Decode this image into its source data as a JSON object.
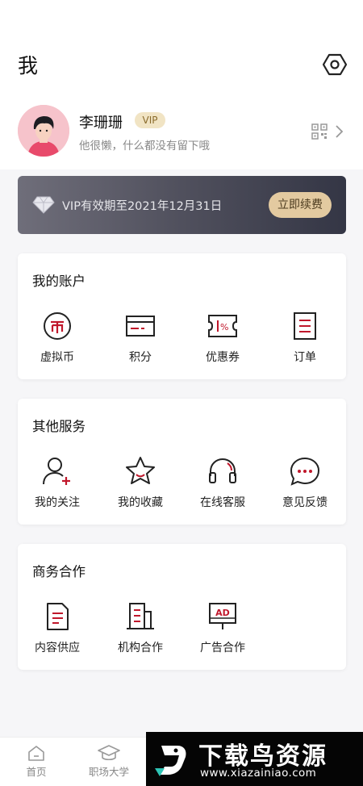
{
  "header": {
    "title": "我",
    "settings_icon": "settings-hexagon-icon"
  },
  "profile": {
    "name": "李珊珊",
    "vip_label": "VIP",
    "bio": "他很懒，什么都没有留下哦",
    "qr_icon": "qr-code-icon",
    "arrow_icon": "chevron-right-icon"
  },
  "vip_banner": {
    "text": "VIP有效期至2021年12月31日",
    "button": "立即续费",
    "icon": "diamond-icon"
  },
  "account": {
    "title": "我的账户",
    "items": [
      {
        "label": "虚拟币",
        "icon": "coin-icon"
      },
      {
        "label": "积分",
        "icon": "card-icon"
      },
      {
        "label": "优惠券",
        "icon": "coupon-icon"
      },
      {
        "label": "订单",
        "icon": "order-icon"
      }
    ]
  },
  "services": {
    "title": "其他服务",
    "items": [
      {
        "label": "我的关注",
        "icon": "follow-user-icon"
      },
      {
        "label": "我的收藏",
        "icon": "star-icon"
      },
      {
        "label": "在线客服",
        "icon": "headset-icon"
      },
      {
        "label": "意见反馈",
        "icon": "chat-bubble-icon"
      }
    ]
  },
  "business": {
    "title": "商务合作",
    "items": [
      {
        "label": "内容供应",
        "icon": "document-icon"
      },
      {
        "label": "机构合作",
        "icon": "building-icon"
      },
      {
        "label": "广告合作",
        "icon": "ad-board-icon",
        "icon_text": "AD"
      }
    ]
  },
  "tabbar": {
    "tabs": [
      {
        "label": "首页",
        "icon": "home-icon"
      },
      {
        "label": "职场大学",
        "icon": "graduation-cap-icon"
      }
    ]
  },
  "watermark": {
    "title": "下载鸟资源",
    "url": "www.xiazainiao.com"
  },
  "colors": {
    "accent_red": "#c0172b",
    "vip_gold": "#e3caa0",
    "banner_dark": "#3a3b49"
  }
}
